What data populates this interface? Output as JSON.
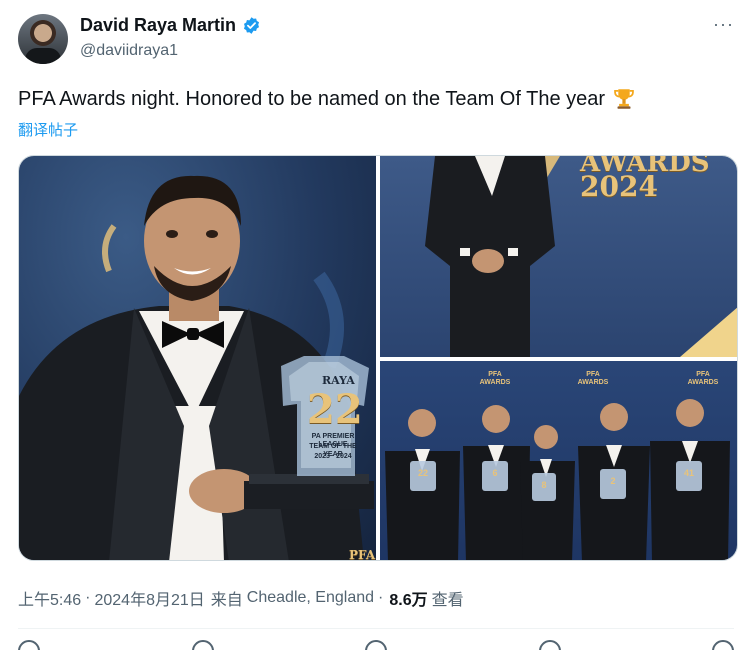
{
  "author": {
    "display_name": "David Raya Martin",
    "handle": "@daviidraya1",
    "verified_icon": "verified-badge-icon",
    "verified_color": "#1d9bf0"
  },
  "header": {
    "more_label": "···"
  },
  "tweet": {
    "text": "PFA Awards night. Honored to be named on the Team Of The year",
    "emoji_icon": "trophy-icon",
    "translate_label": "翻译帖子"
  },
  "media": {
    "photo1": {
      "trophy_name": "RAYA",
      "trophy_number": "22",
      "trophy_caption_1": "PA PREMIER LEAGUE",
      "trophy_caption_2": "TEAM OF THE YEAR",
      "trophy_caption_3": "2023 · 2024",
      "corner_text": "PFA"
    },
    "photo2": {
      "awards_word": "AWARDS",
      "year": "2024"
    },
    "photo3": {
      "banner_top": "PFA",
      "banner_bottom": "AWARDS",
      "player_numbers": [
        "22",
        "6",
        "8",
        "2",
        "41"
      ]
    }
  },
  "meta": {
    "time": "上午5:46",
    "separator": "·",
    "date": "2024年8月21日",
    "source_prefix": "来自",
    "location": "Cheadle, England",
    "views_count": "8.6万",
    "views_label": "查看"
  },
  "colors": {
    "accent": "#1d9bf0",
    "text_primary": "#0f1419",
    "text_secondary": "#536471",
    "gold": "#e8c37a"
  }
}
